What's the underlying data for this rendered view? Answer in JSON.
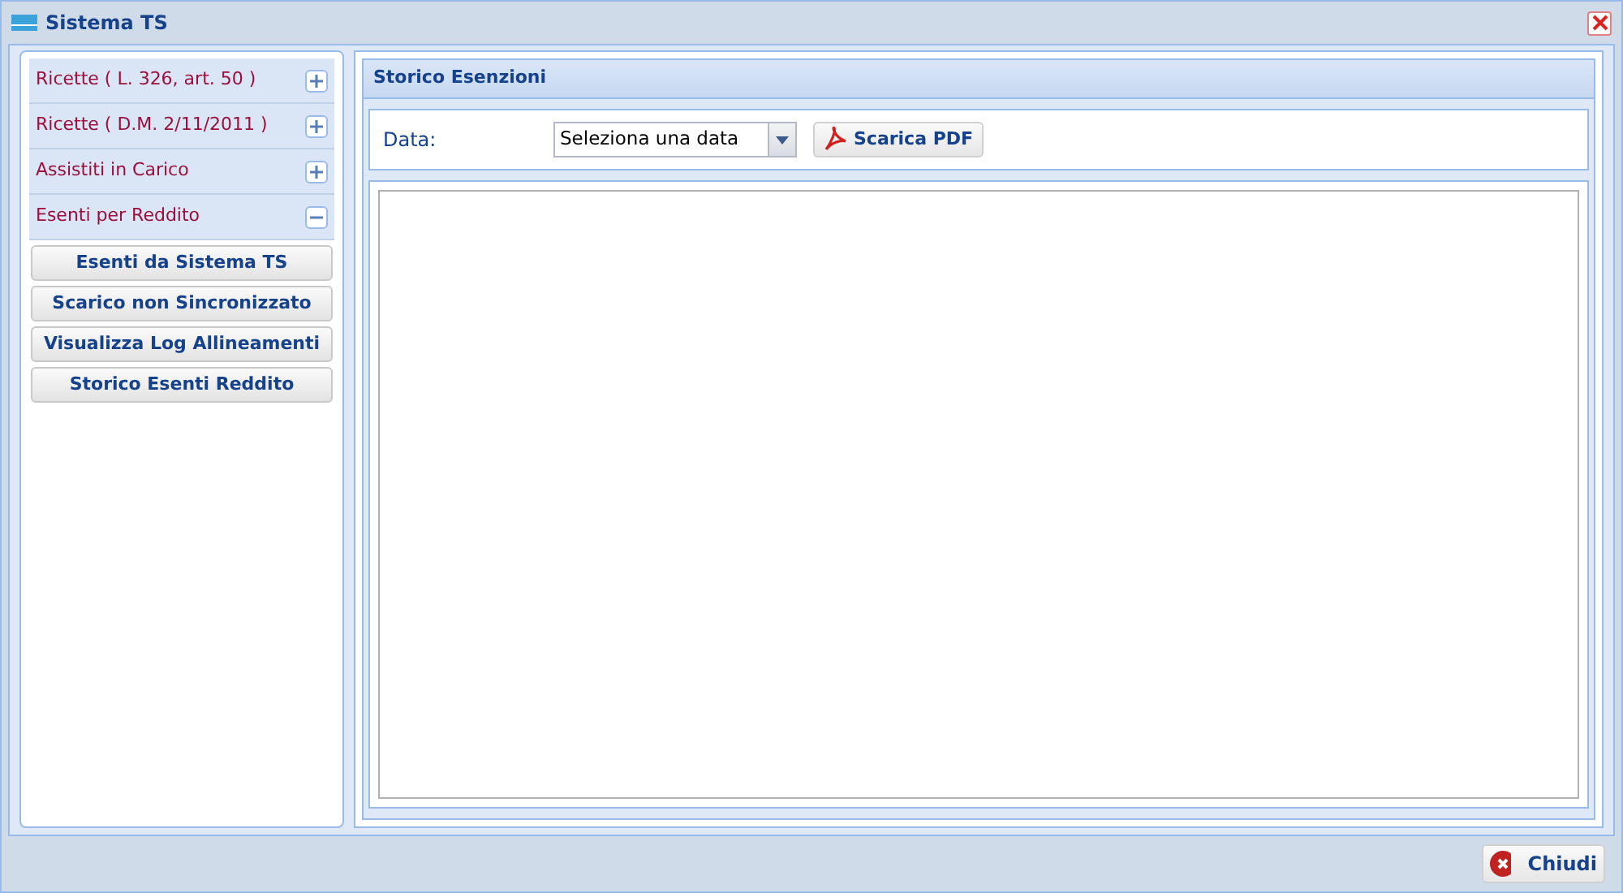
{
  "window": {
    "title": "Sistema TS"
  },
  "sidebar": {
    "sections": [
      {
        "label": "Ricette ( L. 326, art. 50 )",
        "expanded": false
      },
      {
        "label": "Ricette ( D.M. 2/11/2011 )",
        "expanded": false
      },
      {
        "label": "Assistiti in Carico",
        "expanded": false
      },
      {
        "label": "Esenti per Reddito",
        "expanded": true,
        "items": [
          "Esenti da Sistema TS",
          "Scarico non Sincronizzato",
          "Visualizza Log Allineamenti",
          "Storico Esenti Reddito"
        ]
      }
    ]
  },
  "panel": {
    "title": "Storico Esenzioni",
    "date_label": "Data:",
    "date_select": {
      "value": "Seleziona una data"
    },
    "pdf_button": "Scarica PDF"
  },
  "footer": {
    "close_button": "Chiudi"
  }
}
